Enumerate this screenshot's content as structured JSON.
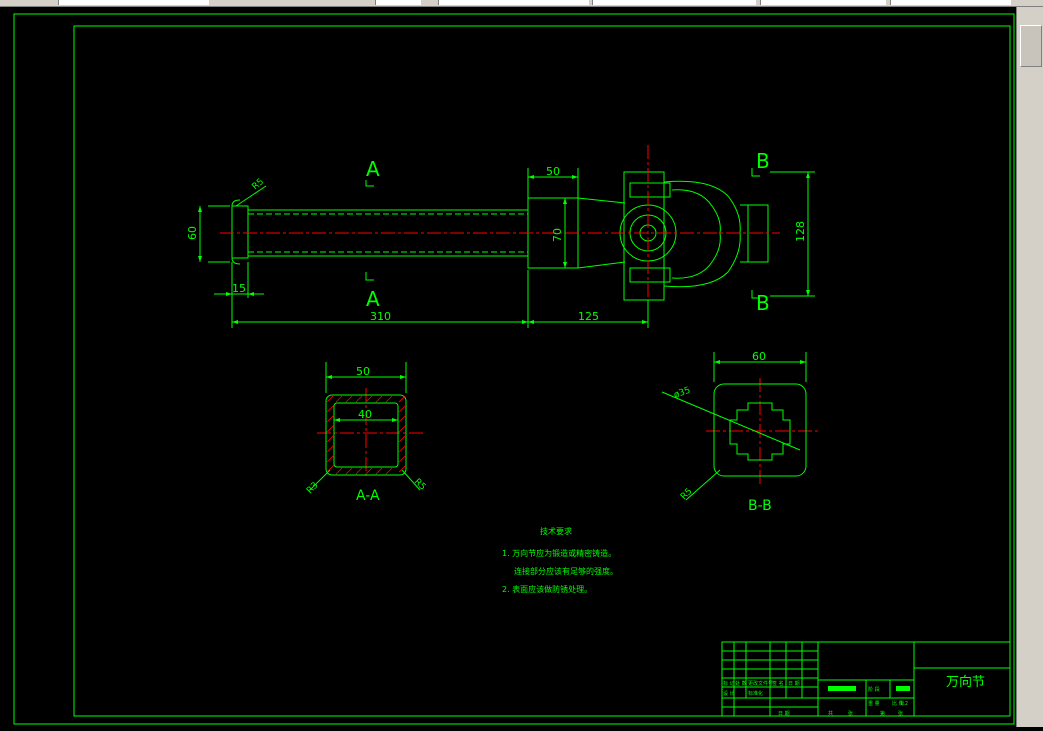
{
  "colors": {
    "background": "#000000",
    "outline": "#00ff00",
    "centerline": "#ff0000",
    "dimension": "#00ff00",
    "hatch": "#ff0000",
    "text": "#00ff00"
  },
  "toolbar": {
    "field_1": "",
    "field_2": ""
  },
  "main_view": {
    "section_a_top": "A",
    "section_a_bottom": "A",
    "section_b_top": "B",
    "section_b_bottom": "B",
    "dim_r5": "R5",
    "dim_60": "60",
    "dim_15": "15",
    "dim_310": "310",
    "dim_125": "125",
    "dim_50": "50",
    "dim_70": "70",
    "dim_128": "128"
  },
  "section_aa": {
    "label": "A-A",
    "dim_outer": "50",
    "dim_inner": "40",
    "dim_r3_left": "R3",
    "dim_r5_right": "R5"
  },
  "section_bb": {
    "label": "B-B",
    "dim_width": "60",
    "dim_dia": "ø35",
    "dim_r5": "R5"
  },
  "tech_requirements": {
    "title": "技术要求",
    "line_1": "1. 万向节应为锻造或精密铸造。",
    "line_2": "连接部分应该有足够的强度。",
    "line_3": "2. 表面应该做防锈处理。"
  },
  "title_block": {
    "part_name": "万向节",
    "cells": {
      "c1": "标 记",
      "c2": "处 数",
      "c3": "更改文件号",
      "c4": "签 名",
      "c5": "日 期",
      "c6": "设 计",
      "c7": "标准化",
      "c8": "阶 段",
      "c9": "重 量",
      "c10": "比 例",
      "c11": "1:2",
      "c12": "日 期",
      "c13": "共",
      "c14": "张",
      "c15": "第",
      "c16": "张"
    }
  }
}
